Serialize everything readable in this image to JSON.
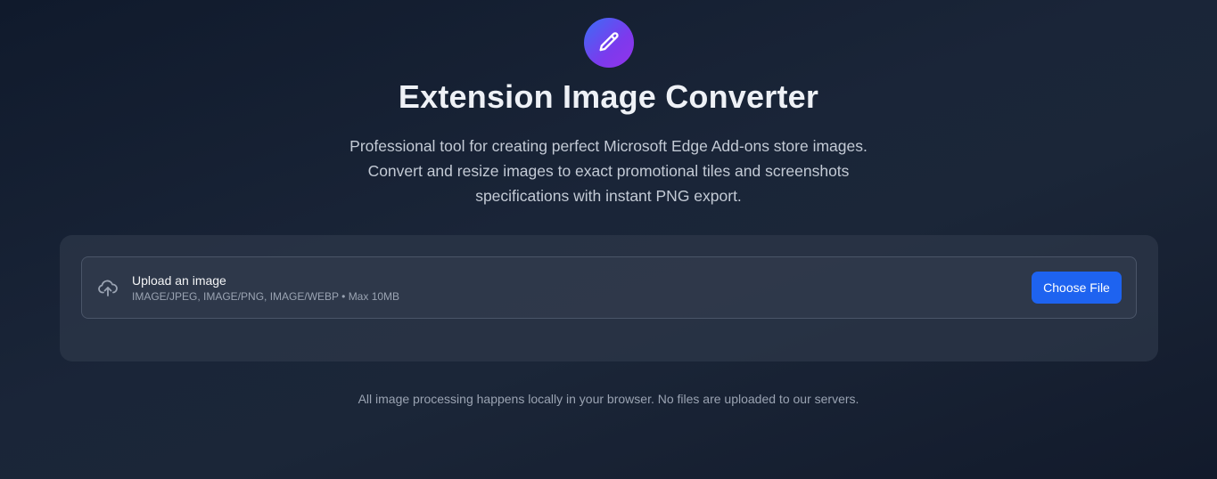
{
  "header": {
    "logo_icon": "pencil-icon",
    "title": "Extension Image Converter",
    "subtitle_lines": [
      "Professional tool for creating perfect Microsoft Edge Add-ons store images.",
      "Convert and resize images to exact promotional tiles and screenshots",
      "specifications with instant PNG export."
    ]
  },
  "upload": {
    "icon": "cloud-upload-icon",
    "title": "Upload an image",
    "hint": "IMAGE/JPEG, IMAGE/PNG, IMAGE/WEBP • Max 10MB",
    "button_label": "Choose File"
  },
  "footer": {
    "note": "All image processing happens locally in your browser. No files are uploaded to our servers."
  },
  "colors": {
    "accent": "#1e63f0",
    "logo_gradient_start": "#3b6ef6",
    "logo_gradient_end": "#9333ea",
    "background": "#1a2538"
  }
}
